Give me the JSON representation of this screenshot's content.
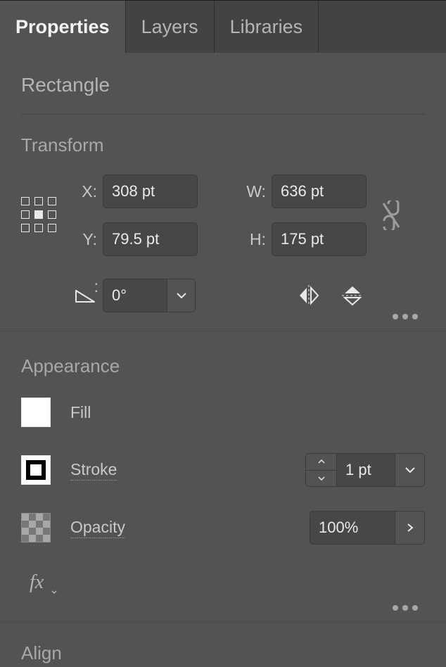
{
  "tabs": {
    "properties": "Properties",
    "layers": "Layers",
    "libraries": "Libraries"
  },
  "selection_name": "Rectangle",
  "transform": {
    "heading": "Transform",
    "x_label": "X:",
    "y_label": "Y:",
    "w_label": "W:",
    "h_label": "H:",
    "x": "308 pt",
    "y": "79.5 pt",
    "w": "636 pt",
    "h": "175 pt",
    "angle_label": ":",
    "angle": "0°"
  },
  "appearance": {
    "heading": "Appearance",
    "fill_label": "Fill",
    "stroke_label": "Stroke",
    "stroke_weight": "1 pt",
    "opacity_label": "Opacity",
    "opacity_value": "100%"
  },
  "align": {
    "heading": "Align"
  }
}
